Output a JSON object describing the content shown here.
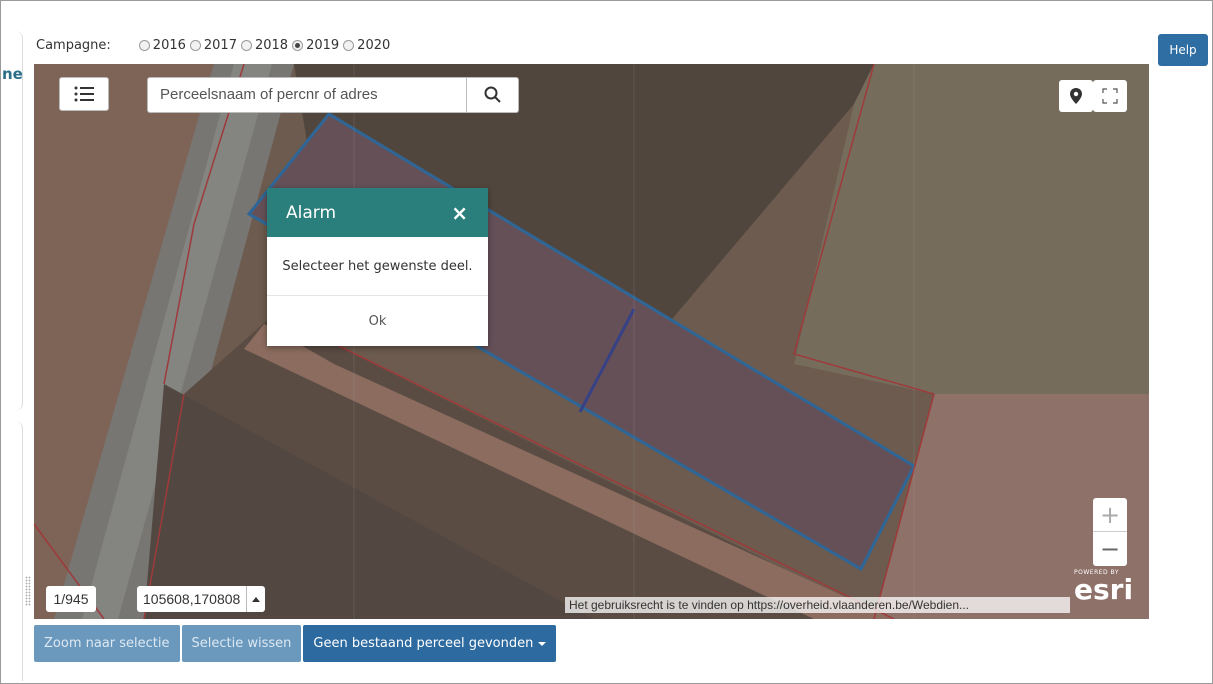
{
  "left_panel": {
    "cut_letter": "ne"
  },
  "campaign": {
    "label": "Campagne:",
    "options": [
      "2016",
      "2017",
      "2018",
      "2019",
      "2020"
    ],
    "selected": "2019"
  },
  "help_label": "Help",
  "map": {
    "search_placeholder": "Perceelsnaam of percnr of adres",
    "counter": "1/945",
    "coordinates": "105608,170808",
    "attribution": "Het gebruiksrecht is te vinden op https://overheid.vlaanderen.be/Webdien...",
    "esri_powered": "POWERED BY",
    "esri_logo": "esri",
    "icons": [
      "list-icon",
      "search-icon",
      "location-pin-icon",
      "fullscreen-icon",
      "zoom-in-icon",
      "zoom-out-icon",
      "caret-up-icon"
    ]
  },
  "dialog": {
    "title": "Alarm",
    "close": "×",
    "message": "Selecteer het gewenste deel.",
    "ok": "Ok",
    "header_color": "#2a7e7b"
  },
  "buttons": {
    "zoom": "Zoom naar selectie",
    "clear": "Selectie wissen",
    "no_parcel": "Geen bestaand perceel gevonden"
  },
  "colors": {
    "primary": "#2c6aa0",
    "parcel_outline": "#0a72c8",
    "field_border": "#d62020"
  }
}
